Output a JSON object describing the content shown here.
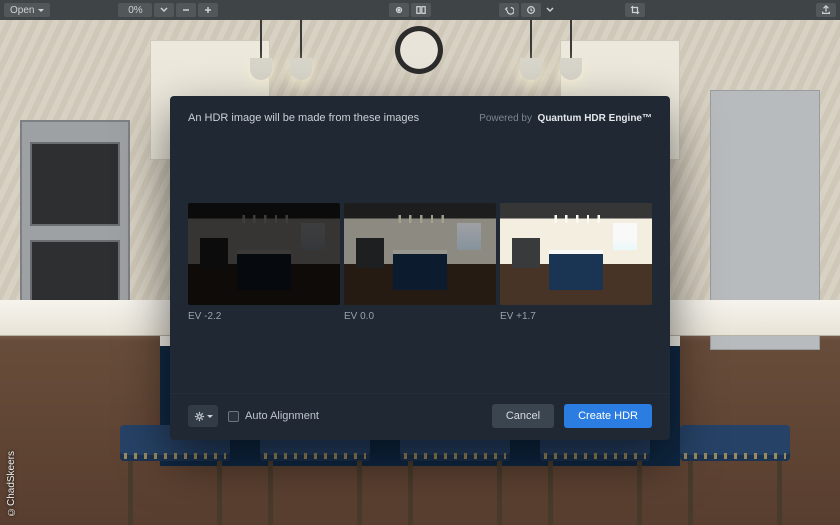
{
  "toolbar": {
    "open_label": "Open",
    "zoom_value": "0%"
  },
  "backdrop": {
    "credit": "©ChadSkeers"
  },
  "modal": {
    "heading": "An HDR image will be made from these images",
    "powered_prefix": "Powered by",
    "powered_name": "Quantum HDR Engine™",
    "thumbs": [
      {
        "ev_label": "EV -2.2",
        "variant": "dark"
      },
      {
        "ev_label": "EV 0.0",
        "variant": "mid"
      },
      {
        "ev_label": "EV +1.7",
        "variant": "bright"
      }
    ],
    "auto_align_label": "Auto Alignment",
    "auto_align_checked": false,
    "cancel_label": "Cancel",
    "create_label": "Create HDR"
  }
}
